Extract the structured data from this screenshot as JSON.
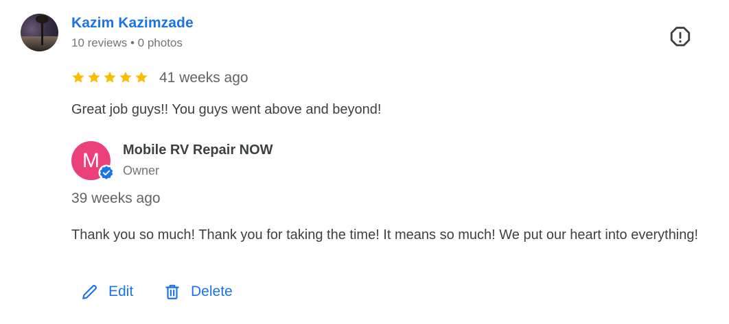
{
  "review": {
    "reviewer": {
      "name": "Kazim Kazimzade",
      "meta": "10 reviews • 0 photos",
      "avatar_icon": "user-photo"
    },
    "rating": 5,
    "time": "41 weeks ago",
    "text": "Great job guys!! You guys went above and beyond!",
    "flag_icon": "report-octagon-icon"
  },
  "reply": {
    "owner": {
      "initial": "M",
      "name": "Mobile RV Repair NOW",
      "role": "Owner",
      "avatar_color": "#ec407a",
      "verified_icon": "verified-badge-icon"
    },
    "time": "39 weeks ago",
    "text": "Thank you so much! Thank you for taking the time! It means so much! We put our heart into everything!"
  },
  "actions": {
    "edit_label": "Edit",
    "delete_label": "Delete"
  },
  "colors": {
    "link_blue": "#1a73e8",
    "star_gold": "#fbbc04",
    "text": "#3c4043",
    "muted": "#70757a"
  }
}
